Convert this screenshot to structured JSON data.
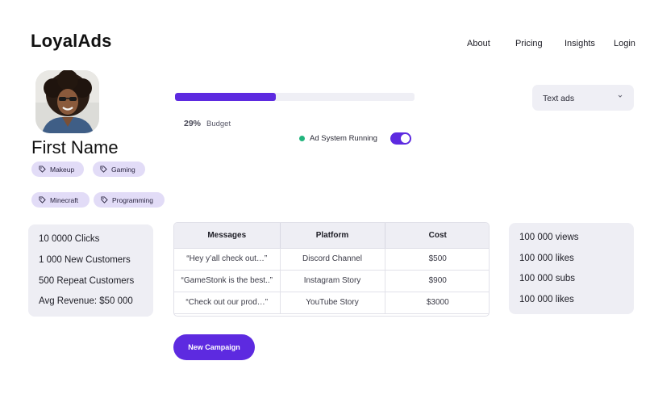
{
  "header": {
    "logo": "LoyalAds",
    "nav": [
      {
        "label": "About"
      },
      {
        "label": "Pricing"
      },
      {
        "label": "Insights"
      },
      {
        "label": "Login"
      }
    ]
  },
  "profile": {
    "name": "First Name",
    "tags": [
      {
        "label": "Makeup",
        "icon": "tag-icon"
      },
      {
        "label": "Gaming",
        "icon": "tag-icon"
      },
      {
        "label": "Minecraft",
        "icon": "tag-icon"
      },
      {
        "label": "Programming",
        "icon": "tag-icon"
      }
    ]
  },
  "budget": {
    "percent_label": "29%",
    "label": "Budget",
    "progress": 0.42
  },
  "status": {
    "text": "Ad System Running",
    "toggle_on": true,
    "dot_color": "#22b47d"
  },
  "dropdown": {
    "value": "Text ads"
  },
  "left_stats": [
    "10 0000 Clicks",
    "1 000 New Customers",
    "500 Repeat Customers",
    "Avg Revenue: $50 000"
  ],
  "right_stats": [
    "100 000 views",
    "100 000 likes",
    "100 000 subs",
    "100 000 likes"
  ],
  "table": {
    "headers": [
      "Messages",
      "Platform",
      "Cost"
    ],
    "rows": [
      [
        "“Hey y’all check out…”",
        "Discord Channel",
        "$500"
      ],
      [
        "“GameStonk is the best..”",
        "Instagram Story",
        "$900"
      ],
      [
        "“Check out our prod…”",
        "YouTube Story",
        "$3000"
      ]
    ]
  },
  "actions": {
    "new_campaign": "New Campaign"
  },
  "colors": {
    "accent": "#5d2ae0",
    "tag_bg": "#e2dcf7",
    "card_bg": "#eeeef4",
    "success": "#22b47d"
  }
}
